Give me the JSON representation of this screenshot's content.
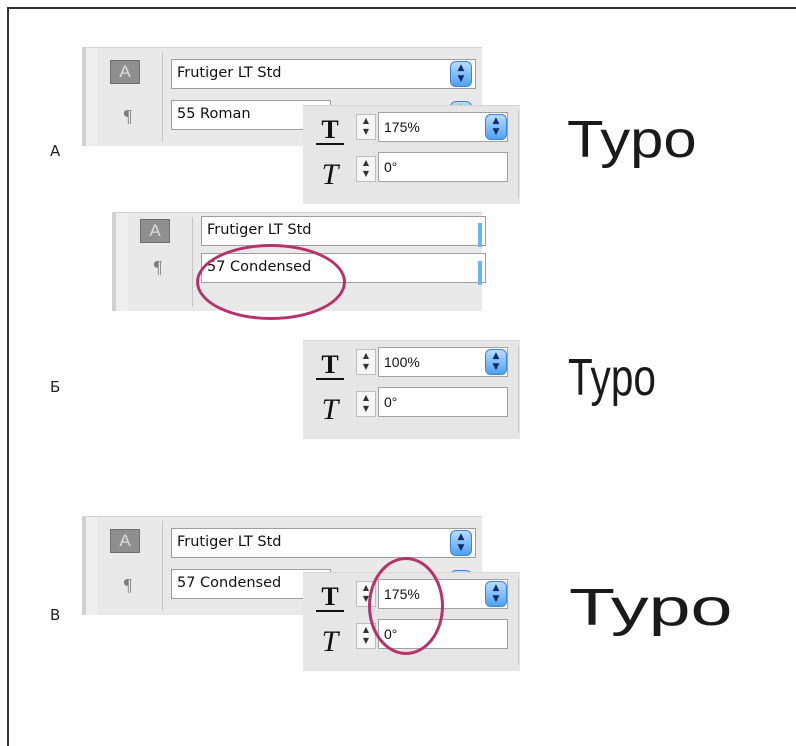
{
  "sections": [
    {
      "label": "А",
      "font_family": "Frutiger LT Std",
      "font_style": "55 Roman",
      "horizontal_scale": "175%",
      "skew": "0°",
      "sample": "Typo"
    },
    {
      "label": "Б",
      "font_family": "Frutiger LT Std",
      "font_style": "57 Condensed",
      "horizontal_scale": "100%",
      "skew": "0°",
      "sample": "Typo"
    },
    {
      "label": "В",
      "font_family": "Frutiger LT Std",
      "font_style": "57 Condensed",
      "horizontal_scale": "175%",
      "skew": "0°",
      "sample": "Typo"
    }
  ],
  "icons": {
    "character_style": "A",
    "paragraph_style": "¶"
  },
  "colors": {
    "highlight_ring": "#b5336a",
    "dropdown_accent": "#4fa0f3"
  }
}
